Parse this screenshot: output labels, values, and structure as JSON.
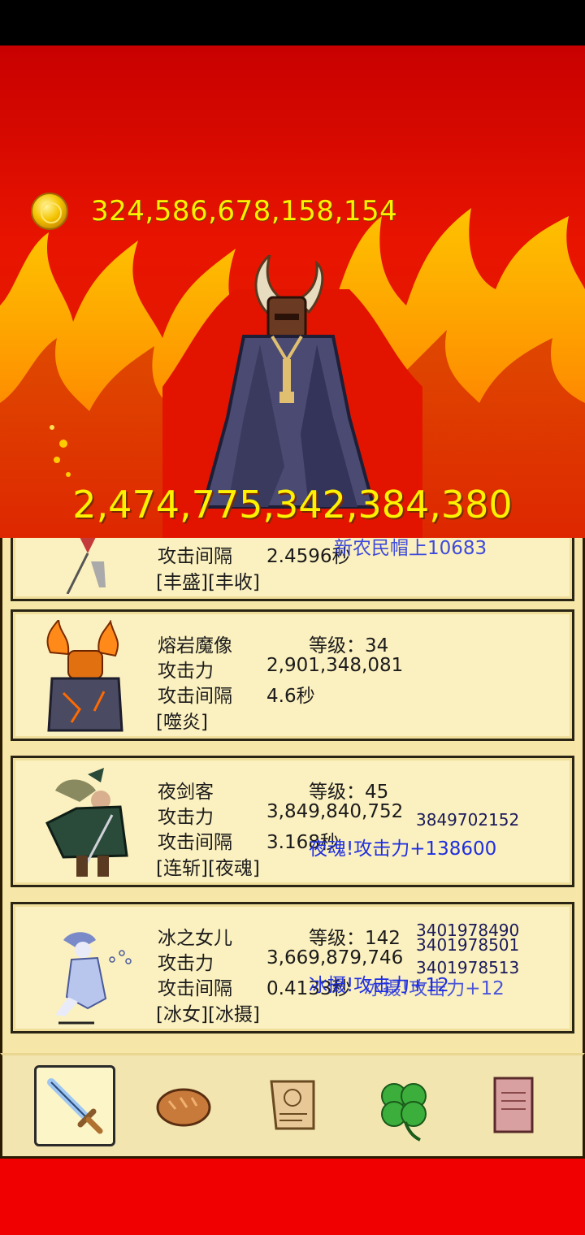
{
  "gold": "324,586,678,158,154",
  "boss": {
    "hp": "2,474,775,342,384,380",
    "icon": "horned-dark-lord"
  },
  "heroes": [
    {
      "icon": "spear-knight-sprite",
      "interval_label": "攻击间隔",
      "interval": "2.4596秒",
      "skills": "[丰盛][丰收]",
      "float_text": "新农民帽上10683"
    },
    {
      "icon": "lava-golem-sprite",
      "name": "熔岩魔像",
      "level_label": "等级：34",
      "attack_label": "攻击力",
      "attack": "2,901,348,081",
      "interval_label": "攻击间隔",
      "interval": "4.6秒",
      "skills": "[噬炎]"
    },
    {
      "icon": "night-swordsman-sprite",
      "name": "夜剑客",
      "level_label": "等级：45",
      "attack_label": "攻击力",
      "attack": "3,849,840,752",
      "interval_label": "攻击间隔",
      "interval": "3.168秒",
      "skills": "[连斩][夜魂]",
      "damage_numbers": [
        "3849702152"
      ],
      "float_text": "夜魂!攻击力+138600"
    },
    {
      "icon": "ice-maiden-sprite",
      "name": "冰之女儿",
      "level_label": "等级：142",
      "attack_label": "攻击力",
      "attack": "3,669,879,746",
      "interval_label": "攻击间隔",
      "interval": "0.4133秒",
      "skills": "[冰女][冰摄]",
      "damage_numbers": [
        "3401978490",
        "3401978501",
        "3401978513"
      ],
      "float_text": "冰摄!攻击力+12",
      "float_text_2": "冰摄!攻击力+12"
    }
  ],
  "tabs": [
    {
      "icon": "sword-icon",
      "active": true
    },
    {
      "icon": "bread-icon",
      "active": false
    },
    {
      "icon": "scroll-icon",
      "active": false
    },
    {
      "icon": "clover-icon",
      "active": false
    },
    {
      "icon": "book-icon",
      "active": false
    }
  ],
  "colors": {
    "fire_bg": "#e01000",
    "panel": "#fbf0bf",
    "gold_text": "#fff200",
    "float_text": "#1f2fe0"
  }
}
